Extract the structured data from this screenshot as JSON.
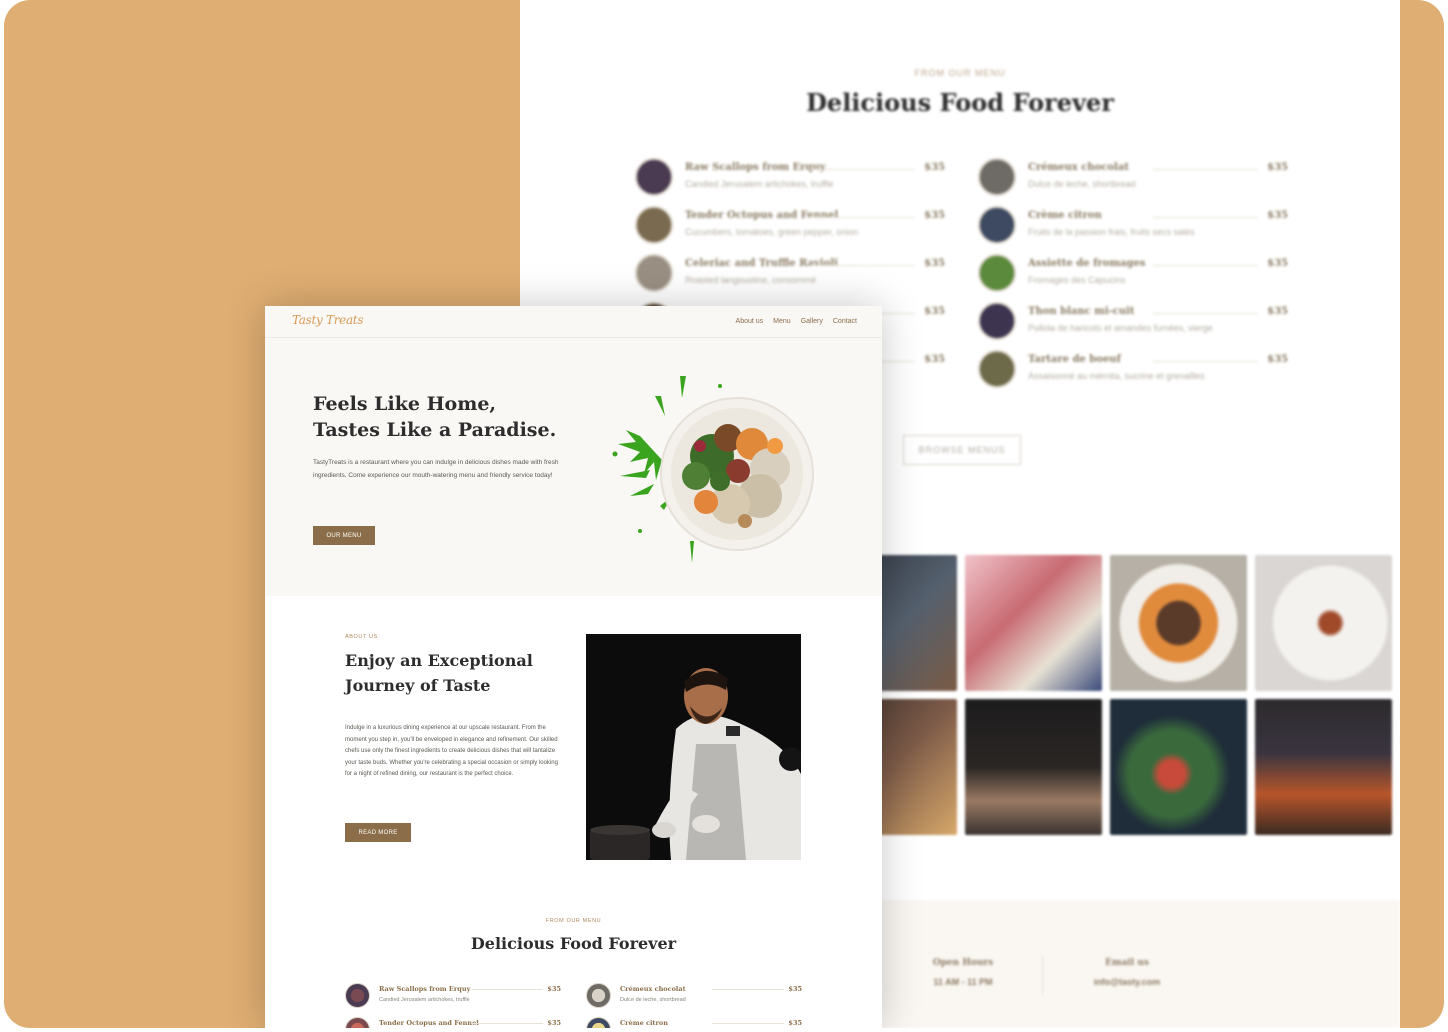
{
  "background_page": {
    "eyebrow": "FROM OUR MENU",
    "title": "Delicious Food Forever",
    "menu_left": [
      {
        "name": "Raw Scallops from Erquy",
        "desc": "Candied Jerusalem artichokes, truffle",
        "price": "$35",
        "color": "#4a3a52"
      },
      {
        "name": "Tender Octopus and Fennel",
        "desc": "Cucumbers, tomatoes, green pepper, onion",
        "price": "$35",
        "color": "#7a6a4f"
      },
      {
        "name": "Celeriac and Truffle Ravioli",
        "desc": "Roasted langoustine, consommé",
        "price": "$35",
        "color": "#9a8f83"
      },
      {
        "name": "",
        "desc": "",
        "price": "$35",
        "color": "#5b4a3a"
      },
      {
        "name": "",
        "desc": "",
        "price": "$35",
        "color": "#6b5a44"
      }
    ],
    "menu_right": [
      {
        "name": "Crémeux chocolat",
        "desc": "Dulce de leche, shortbread",
        "price": "$35",
        "color": "#6e6a65"
      },
      {
        "name": "Crème citron",
        "desc": "Fruits de la passion frais, fruits secs salés",
        "price": "$35",
        "color": "#3e4a62"
      },
      {
        "name": "Assiette de fromages",
        "desc": "Fromages des Capucins",
        "price": "$35",
        "color": "#5b8a3c"
      },
      {
        "name": "Thon blanc mi-cuit",
        "desc": "Pollola de haricots et amandes fumées, vierge",
        "price": "$35",
        "color": "#3d3550"
      },
      {
        "name": "Tartare de boeuf",
        "desc": "Assaisonné au mérnita, sucrine et grenailles",
        "price": "$35",
        "color": "#6d6a4a"
      }
    ],
    "browse_button": "BROWSE MENUS",
    "gallery_colors": [
      "#3a3f4a",
      "#c86a72",
      "#c98a4c",
      "#d9d6d3",
      "#4a3a35",
      "#2a2624",
      "#2f4a38",
      "#2d2a2d"
    ],
    "footer": {
      "hours_label": "Open Hours",
      "hours_value": "11 AM - 11 PM",
      "email_label": "Email us",
      "email_value": "info@tasty.com"
    }
  },
  "front_page": {
    "logo": "Tasty Treats",
    "nav": [
      "About us",
      "Menu",
      "Gallery",
      "Contact"
    ],
    "hero": {
      "title_line1": "Feels Like Home,",
      "title_line2": "Tastes Like a Paradise.",
      "text": "TastyTreats is a restaurant where you can indulge in delicious dishes made with fresh ingredients. Come experience our mouth-watering menu and friendly service today!",
      "button": "OUR MENU"
    },
    "about": {
      "eyebrow": "ABOUT US",
      "title_line1": "Enjoy an Exceptional",
      "title_line2": "Journey of Taste",
      "text": "Indulge in a luxurious dining experience at our upscale restaurant. From the moment you step in, you'll be enveloped in elegance and refinement. Our skilled chefs use only the finest ingredients to create delicious dishes that will tantalize your taste buds. Whether you're celebrating a special occasion or simply looking for a night of refined dining, our restaurant is the perfect choice.",
      "button": "READ MORE"
    },
    "menu": {
      "eyebrow": "FROM OUR MENU",
      "title": "Delicious Food Forever",
      "left": [
        {
          "name": "Raw Scallops from Erquy",
          "desc": "Candied Jerusalem artichokes, truffle",
          "price": "$35",
          "color": "#4a3a52"
        },
        {
          "name": "Tender Octopus and Fennel",
          "desc": "",
          "price": "$35",
          "color": "#7a4a4f"
        }
      ],
      "right": [
        {
          "name": "Crémeux chocolat",
          "desc": "Dulce de leche, shortbread",
          "price": "$35",
          "color": "#6e6a65"
        },
        {
          "name": "Crème citron",
          "desc": "",
          "price": "$35",
          "color": "#3e4a62"
        }
      ]
    }
  },
  "colors": {
    "background": "#dfae73",
    "accent": "#8b6e49",
    "logo": "#d99a58",
    "hero_bg": "#faf8f5"
  }
}
